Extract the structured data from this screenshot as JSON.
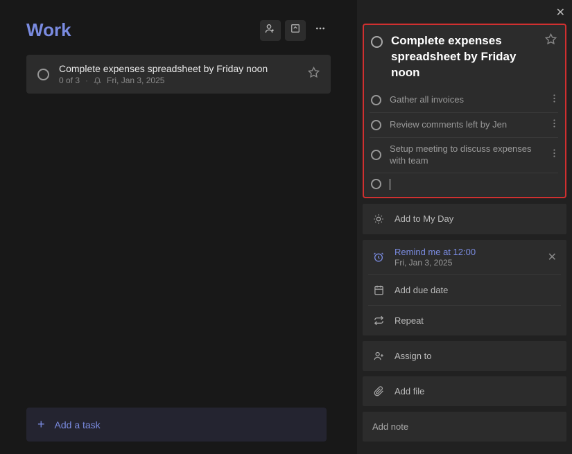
{
  "header": {
    "title": "Work"
  },
  "task": {
    "title": "Complete expenses spreadsheet by Friday noon",
    "progress": "0 of 3",
    "date": "Fri, Jan 3, 2025"
  },
  "add_task": "Add a task",
  "details": {
    "title": "Complete expenses spreadsheet by Friday noon",
    "steps": [
      "Gather all invoices",
      "Review comments left by Jen",
      "Setup meeting to discuss expenses with team"
    ],
    "add_to_my_day": "Add to My Day",
    "reminder": {
      "label": "Remind me at 12:00",
      "date": "Fri, Jan 3, 2025"
    },
    "due_date": "Add due date",
    "repeat": "Repeat",
    "assign": "Assign to",
    "add_file": "Add file",
    "add_note": "Add note"
  }
}
